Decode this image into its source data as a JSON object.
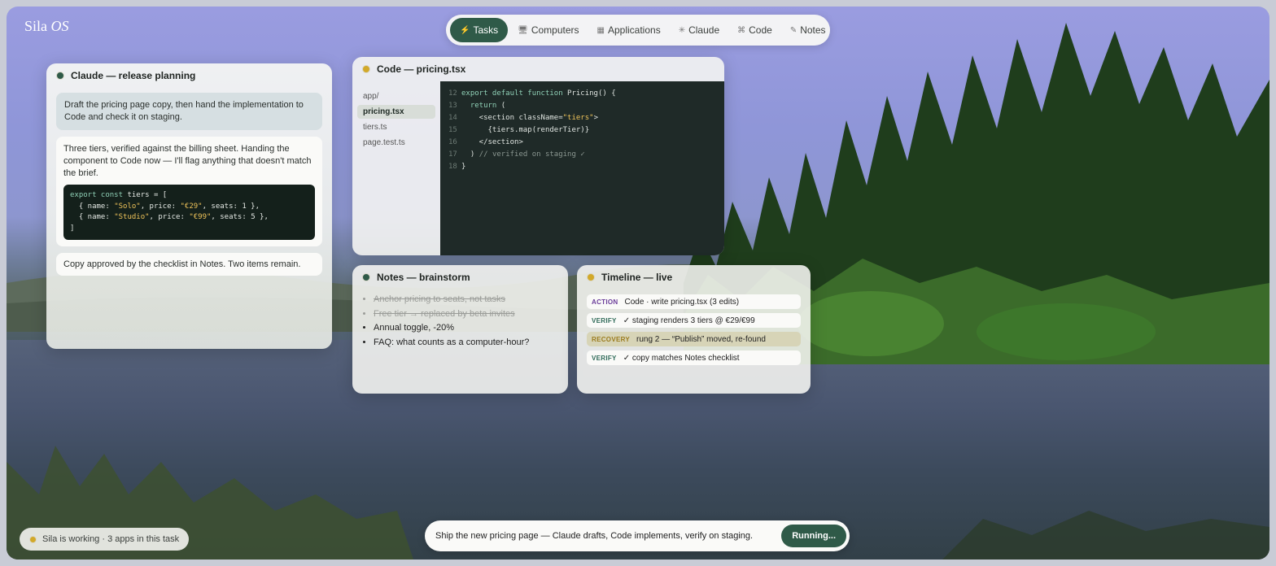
{
  "brand": {
    "name": "Sila",
    "suffix": "OS"
  },
  "nav": {
    "items": [
      {
        "icon": "⚡",
        "label": "Tasks",
        "active": true
      },
      {
        "icon": "🖥",
        "label": "Computers"
      },
      {
        "icon": "▦",
        "label": "Applications"
      },
      {
        "icon": "✳",
        "label": "Claude"
      },
      {
        "icon": "⌘",
        "label": "Code"
      },
      {
        "icon": "✎",
        "label": "Notes"
      }
    ]
  },
  "claude_window": {
    "title": "Claude — release planning",
    "user_message": "Draft the pricing page copy, then hand the implementation to Code and check it on staging.",
    "assistant_message": "Three tiers, verified against the billing sheet. Handing the component to Code now — I'll flag anything that doesn't match the brief.",
    "code": {
      "line1_kw": "export const",
      "line1_rest": " tiers = [",
      "line2_a": "  { name: ",
      "line2_s1": "\"Solo\"",
      "line2_b": ", price: ",
      "line2_s2": "\"€29\"",
      "line2_c": ", seats: 1 },",
      "line3_a": "  { name: ",
      "line3_s1": "\"Studio\"",
      "line3_b": ", price: ",
      "line3_s2": "\"€99\"",
      "line3_c": ", seats: 5 },",
      "line4": "]"
    },
    "note_message": "Copy approved by the checklist in Notes. Two items remain."
  },
  "code_window": {
    "title": "Code — pricing.tsx",
    "files": [
      "app/",
      "pricing.tsx",
      "tiers.ts",
      "page.test.ts"
    ],
    "lines": [
      {
        "n": "12",
        "kw": "export default function",
        "rest": " Pricing() {"
      },
      {
        "n": "13",
        "kw": "  return",
        "rest": " ("
      },
      {
        "n": "14",
        "kw": "",
        "rest": "    <section className=",
        "str": "\"tiers\"",
        "after": ">"
      },
      {
        "n": "15",
        "kw": "",
        "rest": "      {tiers.map(renderTier)}"
      },
      {
        "n": "16",
        "kw": "",
        "rest": "    </section>"
      },
      {
        "n": "17",
        "kw": "",
        "rest": "  ) ",
        "comment": "// verified on staging ✓"
      },
      {
        "n": "18",
        "kw": "",
        "rest": "}"
      }
    ]
  },
  "notes_window": {
    "title": "Notes — brainstorm",
    "items": [
      {
        "text": "Anchor pricing to seats, not tasks",
        "done": true
      },
      {
        "text": "Free tier → replaced by beta invites",
        "done": true
      },
      {
        "text": "Annual toggle, -20%",
        "done": false
      },
      {
        "text": "FAQ: what counts as a computer-hour?",
        "done": false
      }
    ]
  },
  "timeline_window": {
    "title": "Timeline — live",
    "events": [
      {
        "tag": "ACTION",
        "text": "Code · write pricing.tsx (3 edits)"
      },
      {
        "tag": "VERIFY",
        "text": "✓ staging renders 3 tiers @ €29/€99"
      },
      {
        "tag": "RECOVERY",
        "text": "rung 2 — “Publish” moved, re-found"
      },
      {
        "tag": "VERIFY",
        "text": "✓ copy matches Notes checklist"
      }
    ]
  },
  "status": {
    "text": "Sila is working · 3 apps in this task"
  },
  "command": {
    "text": "Ship the new pricing page — Claude drafts, Code implements, verify on staging.",
    "button": "Running..."
  },
  "colors": {
    "accent": "#2f5a48",
    "status_dot": "#d2a92a"
  }
}
